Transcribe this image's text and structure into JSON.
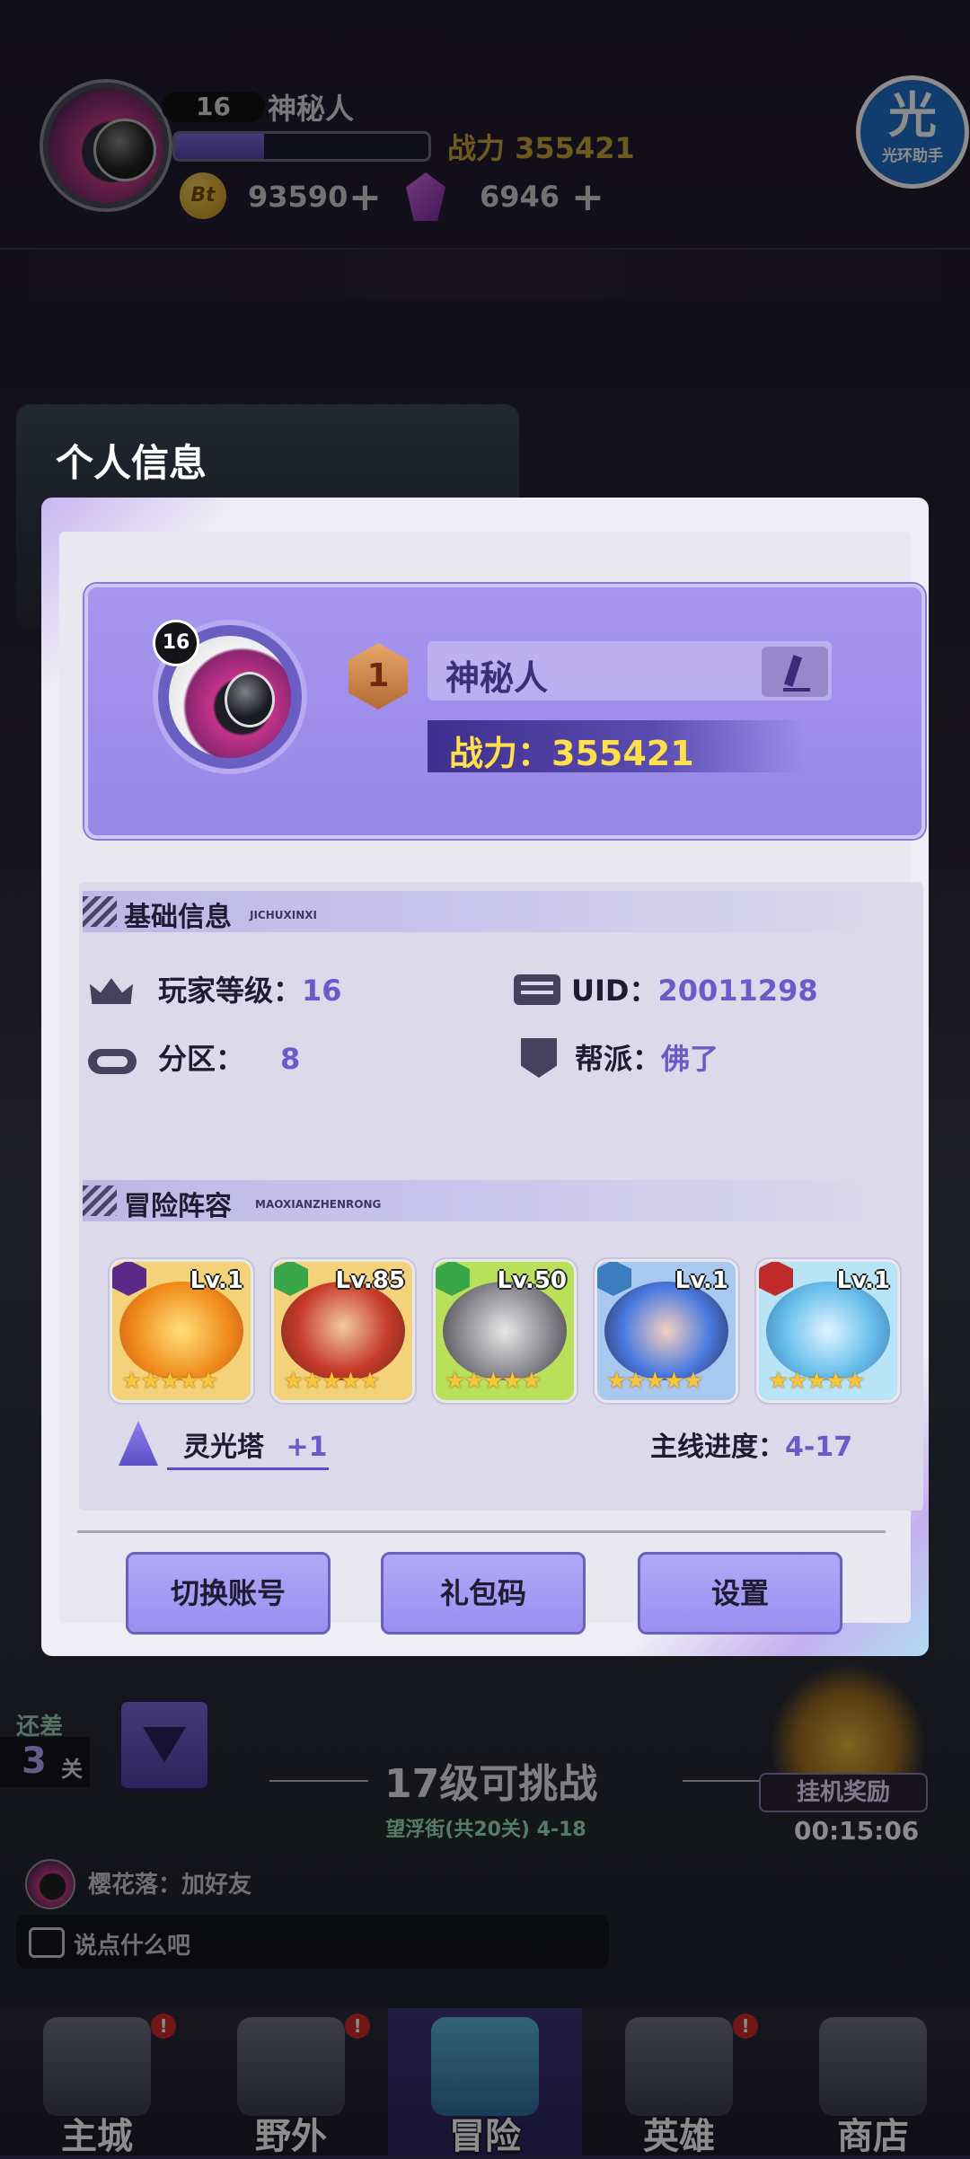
{
  "hud": {
    "level": "16",
    "name": "神秘人",
    "exp_fraction": 0.35,
    "power": "战力 355421",
    "coin_symbol": "Bt",
    "coins": "93590",
    "gems": "6946",
    "plus": "+",
    "helper_big": "光",
    "helper_small": "光环助手"
  },
  "modal": {
    "title": "个人信息",
    "profile": {
      "level": "16",
      "rank": "1",
      "name": "神秘人",
      "power": "战力：355421"
    },
    "basic": {
      "header": "基础信息",
      "header_sub": "JICHUXINXI",
      "player_level_label": "玩家等级：",
      "player_level": "16",
      "uid_label": "UID：",
      "uid": "20011298",
      "server_label": "分区：",
      "server": "8",
      "guild_label": "帮派：",
      "guild": "佛了"
    },
    "lineup": {
      "header": "冒险阵容",
      "header_sub": "MAOXIANZHENRONG",
      "heroes": [
        {
          "level": "Lv.1",
          "stars": "★★★★★",
          "element_color": "#5b2a86",
          "bg": "#f2b338"
        },
        {
          "level": "Lv.85",
          "stars": "★★★★★",
          "element_color": "#3aa64a",
          "bg": "#e89a3a"
        },
        {
          "level": "Lv.50",
          "stars": "★★★★★",
          "element_color": "#3aa64a",
          "bg": "#9ed24a"
        },
        {
          "level": "Lv.1",
          "stars": "★★★★★",
          "element_color": "#3a7ec0",
          "bg": "#7aa8e8"
        },
        {
          "level": "Lv.1",
          "stars": "★★★★★",
          "element_color": "#c02a2a",
          "bg": "#7ec8f0"
        }
      ],
      "tower_label": "灵光塔",
      "tower_value": "+1",
      "progress_label": "主线进度：",
      "progress_value": "4-17"
    },
    "buttons": {
      "switch_account": "切换账号",
      "gift_code": "礼包码",
      "settings": "设置"
    }
  },
  "background": {
    "still_short_label": "还差",
    "still_short_count": "3",
    "still_short_unit": "关",
    "challenge": "17级可挑战",
    "stage": "望浮街(共20关) 4-18",
    "afk_reward": "挂机奖励",
    "afk_timer": "00:15:06",
    "chat_message": "樱花落：加好友",
    "chat_placeholder": "说点什么吧"
  },
  "nav": {
    "items": [
      {
        "label": "主城",
        "badge": "!"
      },
      {
        "label": "野外",
        "badge": "!"
      },
      {
        "label": "冒险",
        "badge": ""
      },
      {
        "label": "英雄",
        "badge": "!"
      },
      {
        "label": "商店",
        "badge": ""
      }
    ]
  }
}
